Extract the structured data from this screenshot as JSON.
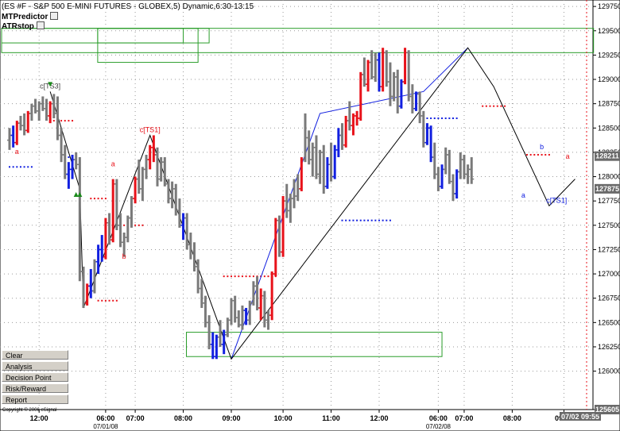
{
  "header": {
    "title": "(ES #F - S&P 500 E-MINI FUTURES - GLOBEX,5) Dynamic,6:30-13:15",
    "study1": "MTPredictor",
    "study2": "ATRstop"
  },
  "side_buttons": [
    "Clear",
    "Analysis",
    "Decision Point",
    "Risk/Reward",
    "Report"
  ],
  "copyright": "Copyright © 2006 eSignal",
  "colors": {
    "up": "#e8121a",
    "down": "#1220e0",
    "neutral": "#7a7a7a",
    "stop": "#e8121a",
    "stop_blue": "#1220e0",
    "box": "#2a9d2a",
    "grid": "#9a9a9a",
    "marker_bg": "#6a6a6a",
    "marker_dark": "#404040"
  },
  "chart_data": {
    "type": "candlestick",
    "symbol": "ES #F",
    "interval": "5",
    "ylim": [
      1256.05,
      1298.0
    ],
    "y_ticks": [
      1260.0,
      1262.5,
      1265.0,
      1267.5,
      1270.0,
      1272.5,
      1275.0,
      1277.5,
      1280.0,
      1282.5,
      1285.0,
      1287.5,
      1290.0,
      1292.5,
      1295.0,
      1297.5
    ],
    "y_tick_labels": [
      "126000",
      "126250",
      "126500",
      "126750",
      "127000",
      "127250",
      "127500",
      "127750",
      "128000",
      "128250",
      "128500",
      "128750",
      "129000",
      "129250",
      "129500",
      "129750"
    ],
    "price_markers": [
      {
        "label": "128211",
        "value": 1282.11
      },
      {
        "label": "127875",
        "value": 1278.75
      },
      {
        "label": "125605",
        "value": 1256.05
      }
    ],
    "x_ticks": [
      {
        "label": "12:00",
        "bar": 8
      },
      {
        "label": "06:00",
        "bar": 26
      },
      {
        "label": "07:00",
        "bar": 34
      },
      {
        "label": "08:00",
        "bar": 47
      },
      {
        "label": "09:00",
        "bar": 60
      },
      {
        "label": "10:00",
        "bar": 74
      },
      {
        "label": "11:00",
        "bar": 87
      },
      {
        "label": "12:00",
        "bar": 100
      },
      {
        "label": "06:00",
        "bar": 116
      },
      {
        "label": "07:00",
        "bar": 123
      },
      {
        "label": "08:00",
        "bar": 136
      },
      {
        "label": "09:00",
        "bar": 150
      }
    ],
    "date_labels": [
      {
        "label": "07/01/08",
        "bar": 26
      },
      {
        "label": "07/02/08",
        "bar": 116
      }
    ],
    "current_time_label": "07/02 09:55",
    "bars": [
      [
        1283.75,
        1285.0,
        1282.75,
        1284.25,
        "n"
      ],
      [
        1284.25,
        1285.25,
        1283.0,
        1283.5,
        "b"
      ],
      [
        1283.5,
        1285.75,
        1283.25,
        1285.5,
        "r"
      ],
      [
        1285.5,
        1286.25,
        1284.75,
        1285.25,
        "n"
      ],
      [
        1285.25,
        1286.5,
        1284.25,
        1284.75,
        "n"
      ],
      [
        1284.75,
        1286.75,
        1284.5,
        1286.5,
        "r"
      ],
      [
        1286.5,
        1287.5,
        1285.75,
        1287.25,
        "n"
      ],
      [
        1287.25,
        1288.0,
        1286.5,
        1286.75,
        "n"
      ],
      [
        1286.75,
        1287.75,
        1285.75,
        1287.5,
        "n"
      ],
      [
        1287.5,
        1288.25,
        1286.75,
        1287.0,
        "n"
      ],
      [
        1287.0,
        1288.0,
        1285.75,
        1286.25,
        "n"
      ],
      [
        1286.25,
        1287.75,
        1285.5,
        1287.5,
        "r"
      ],
      [
        1287.5,
        1288.5,
        1286.0,
        1286.5,
        "n"
      ],
      [
        1286.5,
        1288.25,
        1283.75,
        1284.25,
        "n"
      ],
      [
        1284.25,
        1285.0,
        1281.5,
        1282.25,
        "n"
      ],
      [
        1282.25,
        1283.25,
        1279.75,
        1280.25,
        "n"
      ],
      [
        1280.25,
        1281.5,
        1278.75,
        1280.75,
        "b"
      ],
      [
        1280.75,
        1282.25,
        1279.75,
        1281.75,
        "b"
      ],
      [
        1281.75,
        1282.5,
        1280.75,
        1281.25,
        "n"
      ],
      [
        1281.25,
        1282.0,
        1269.25,
        1270.25,
        "n"
      ],
      [
        1270.25,
        1270.75,
        1266.5,
        1267.0,
        "n"
      ],
      [
        1267.0,
        1269.0,
        1266.75,
        1268.75,
        "r"
      ],
      [
        1268.75,
        1270.5,
        1267.5,
        1268.25,
        "b"
      ],
      [
        1268.25,
        1271.5,
        1268.0,
        1271.25,
        "n"
      ],
      [
        1271.25,
        1273.0,
        1270.0,
        1272.5,
        "b"
      ],
      [
        1272.5,
        1274.0,
        1271.25,
        1271.75,
        "b"
      ],
      [
        1271.75,
        1275.75,
        1271.5,
        1275.25,
        "r"
      ],
      [
        1275.25,
        1276.25,
        1273.0,
        1273.5,
        "n"
      ],
      [
        1273.5,
        1279.75,
        1273.25,
        1279.25,
        "r"
      ],
      [
        1279.25,
        1279.75,
        1274.5,
        1275.0,
        "n"
      ],
      [
        1275.0,
        1276.25,
        1272.75,
        1273.25,
        "n"
      ],
      [
        1273.25,
        1274.25,
        1271.75,
        1273.75,
        "n"
      ],
      [
        1273.75,
        1276.0,
        1273.25,
        1275.75,
        "n"
      ],
      [
        1275.75,
        1278.0,
        1274.75,
        1277.75,
        "n"
      ],
      [
        1277.75,
        1280.0,
        1277.25,
        1279.75,
        "r"
      ],
      [
        1279.75,
        1281.75,
        1278.25,
        1278.75,
        "n"
      ],
      [
        1278.75,
        1281.0,
        1277.5,
        1280.75,
        "n"
      ],
      [
        1280.75,
        1282.25,
        1279.75,
        1281.75,
        "n"
      ],
      [
        1281.75,
        1283.25,
        1280.75,
        1283.0,
        "r"
      ],
      [
        1283.0,
        1284.25,
        1281.5,
        1282.25,
        "r"
      ],
      [
        1282.25,
        1283.0,
        1279.0,
        1279.75,
        "n"
      ],
      [
        1279.75,
        1282.0,
        1279.5,
        1281.5,
        "n"
      ],
      [
        1281.5,
        1282.0,
        1279.0,
        1279.25,
        "n"
      ],
      [
        1279.25,
        1279.75,
        1277.25,
        1277.75,
        "n"
      ],
      [
        1277.75,
        1279.5,
        1276.75,
        1278.75,
        "n"
      ],
      [
        1278.75,
        1279.25,
        1276.0,
        1276.5,
        "n"
      ],
      [
        1276.5,
        1277.75,
        1274.75,
        1275.0,
        "n"
      ],
      [
        1275.0,
        1276.25,
        1273.5,
        1275.75,
        "b"
      ],
      [
        1275.75,
        1276.25,
        1272.5,
        1273.0,
        "n"
      ],
      [
        1273.0,
        1274.25,
        1271.5,
        1272.25,
        "n"
      ],
      [
        1272.25,
        1273.25,
        1270.25,
        1270.75,
        "n"
      ],
      [
        1270.75,
        1271.5,
        1268.0,
        1268.5,
        "n"
      ],
      [
        1268.5,
        1269.5,
        1266.5,
        1267.0,
        "n"
      ],
      [
        1267.0,
        1267.75,
        1264.5,
        1265.0,
        "n"
      ],
      [
        1265.0,
        1265.75,
        1262.25,
        1262.75,
        "n"
      ],
      [
        1262.75,
        1264.0,
        1261.25,
        1261.5,
        "b"
      ],
      [
        1261.5,
        1263.75,
        1261.25,
        1263.5,
        "b"
      ],
      [
        1263.5,
        1265.25,
        1262.5,
        1262.75,
        "n"
      ],
      [
        1262.75,
        1264.25,
        1261.75,
        1263.75,
        "b"
      ],
      [
        1263.75,
        1265.5,
        1263.5,
        1265.25,
        "n"
      ],
      [
        1265.25,
        1267.5,
        1264.75,
        1267.25,
        "n"
      ],
      [
        1267.25,
        1267.75,
        1265.0,
        1265.5,
        "n"
      ],
      [
        1265.5,
        1266.25,
        1264.5,
        1264.75,
        "n"
      ],
      [
        1264.75,
        1266.75,
        1264.25,
        1266.25,
        "n"
      ],
      [
        1266.25,
        1266.5,
        1264.75,
        1265.25,
        "b"
      ],
      [
        1265.25,
        1267.25,
        1264.75,
        1267.0,
        "n"
      ],
      [
        1267.0,
        1269.25,
        1266.75,
        1268.75,
        "n"
      ],
      [
        1268.75,
        1269.75,
        1266.25,
        1266.5,
        "n"
      ],
      [
        1266.5,
        1268.5,
        1265.25,
        1267.75,
        "r"
      ],
      [
        1267.75,
        1268.25,
        1264.5,
        1265.25,
        "n"
      ],
      [
        1265.25,
        1266.25,
        1264.25,
        1265.75,
        "n"
      ],
      [
        1265.75,
        1270.25,
        1265.25,
        1270.0,
        "r"
      ],
      [
        1270.0,
        1275.75,
        1269.75,
        1275.5,
        "r"
      ],
      [
        1275.5,
        1276.0,
        1271.75,
        1272.25,
        "n"
      ],
      [
        1272.25,
        1278.0,
        1271.75,
        1277.5,
        "r"
      ],
      [
        1277.5,
        1279.25,
        1275.75,
        1276.5,
        "n"
      ],
      [
        1276.5,
        1278.25,
        1275.25,
        1277.75,
        "n"
      ],
      [
        1277.75,
        1279.75,
        1276.75,
        1278.0,
        "n"
      ],
      [
        1278.0,
        1280.25,
        1277.5,
        1278.75,
        "n"
      ],
      [
        1278.75,
        1282.0,
        1278.5,
        1281.75,
        "r"
      ],
      [
        1281.75,
        1286.5,
        1281.5,
        1284.0,
        "n"
      ],
      [
        1284.0,
        1284.75,
        1281.25,
        1281.75,
        "n"
      ],
      [
        1281.75,
        1283.5,
        1280.0,
        1283.0,
        "n"
      ],
      [
        1283.0,
        1284.25,
        1279.75,
        1280.25,
        "n"
      ],
      [
        1280.25,
        1282.75,
        1279.25,
        1282.5,
        "n"
      ],
      [
        1282.5,
        1283.25,
        1278.25,
        1279.0,
        "n"
      ],
      [
        1279.0,
        1282.0,
        1278.75,
        1281.25,
        "b"
      ],
      [
        1281.25,
        1283.5,
        1279.5,
        1280.0,
        "n"
      ],
      [
        1280.0,
        1283.25,
        1279.75,
        1282.75,
        "b"
      ],
      [
        1282.75,
        1285.0,
        1282.0,
        1284.25,
        "b"
      ],
      [
        1284.25,
        1285.5,
        1282.75,
        1283.25,
        "n"
      ],
      [
        1283.25,
        1286.25,
        1283.0,
        1285.75,
        "r"
      ],
      [
        1285.75,
        1287.75,
        1284.75,
        1285.25,
        "n"
      ],
      [
        1285.25,
        1286.5,
        1284.25,
        1286.25,
        "r"
      ],
      [
        1286.25,
        1286.75,
        1285.25,
        1286.0,
        "r"
      ],
      [
        1286.0,
        1290.75,
        1285.75,
        1290.5,
        "r"
      ],
      [
        1290.5,
        1292.25,
        1289.25,
        1289.5,
        "n"
      ],
      [
        1289.5,
        1292.0,
        1288.75,
        1291.75,
        "r"
      ],
      [
        1291.75,
        1293.0,
        1290.0,
        1290.25,
        "n"
      ],
      [
        1290.25,
        1292.75,
        1289.75,
        1292.0,
        "n"
      ],
      [
        1292.0,
        1292.75,
        1288.75,
        1289.25,
        "b"
      ],
      [
        1289.25,
        1293.25,
        1288.75,
        1292.75,
        "r"
      ],
      [
        1292.75,
        1293.0,
        1289.25,
        1289.75,
        "n"
      ],
      [
        1289.75,
        1291.75,
        1287.25,
        1288.25,
        "n"
      ],
      [
        1288.25,
        1290.75,
        1287.75,
        1290.25,
        "n"
      ],
      [
        1290.25,
        1291.0,
        1286.5,
        1287.25,
        "n"
      ],
      [
        1287.25,
        1290.0,
        1287.0,
        1289.75,
        "b"
      ],
      [
        1289.75,
        1293.25,
        1289.5,
        1292.75,
        "r"
      ],
      [
        1292.75,
        1293.0,
        1287.75,
        1288.25,
        "n"
      ],
      [
        1288.25,
        1289.5,
        1286.5,
        1287.0,
        "n"
      ],
      [
        1287.0,
        1288.75,
        1286.75,
        1288.5,
        "b"
      ],
      [
        1288.5,
        1288.75,
        1285.5,
        1286.25,
        "n"
      ],
      [
        1286.25,
        1286.75,
        1283.0,
        1283.5,
        "n"
      ],
      [
        1283.5,
        1285.5,
        1283.25,
        1285.0,
        "b"
      ],
      [
        1285.0,
        1285.25,
        1281.5,
        1282.0,
        "b"
      ],
      [
        1282.0,
        1283.5,
        1279.75,
        1280.25,
        "n"
      ],
      [
        1280.25,
        1281.0,
        1278.5,
        1279.0,
        "n"
      ],
      [
        1279.0,
        1281.25,
        1278.75,
        1280.75,
        "b"
      ],
      [
        1280.75,
        1283.0,
        1280.25,
        1282.25,
        "n"
      ],
      [
        1282.25,
        1282.75,
        1279.25,
        1279.5,
        "n"
      ],
      [
        1279.5,
        1280.25,
        1277.5,
        1278.25,
        "n"
      ],
      [
        1278.25,
        1280.75,
        1277.75,
        1280.5,
        "b"
      ],
      [
        1280.5,
        1282.5,
        1279.75,
        1281.75,
        "n"
      ],
      [
        1281.75,
        1282.25,
        1279.75,
        1280.25,
        "n"
      ],
      [
        1280.25,
        1281.25,
        1279.25,
        1280.75,
        "n"
      ],
      [
        1280.75,
        1282.0,
        1279.25,
        1279.75,
        "n"
      ]
    ],
    "atr_stop": [
      {
        "from": 0,
        "to": 6,
        "value": 1281.0,
        "side": "b"
      },
      {
        "from": 12,
        "to": 17,
        "value": 1285.75,
        "side": "r"
      },
      {
        "from": 14,
        "to": 17,
        "value": 1282.0,
        "side": "b"
      },
      {
        "from": 22,
        "to": 26,
        "value": 1277.75,
        "side": "r"
      },
      {
        "from": 24,
        "to": 29,
        "value": 1267.25,
        "side": "r"
      },
      {
        "from": 30,
        "to": 36,
        "value": 1275.0,
        "side": "r"
      },
      {
        "from": 58,
        "to": 72,
        "value": 1269.75,
        "side": "r"
      },
      {
        "from": 90,
        "to": 103,
        "value": 1275.5,
        "side": "b"
      },
      {
        "from": 113,
        "to": 121,
        "value": 1286.0,
        "side": "b"
      },
      {
        "from": 128,
        "to": 134,
        "value": 1287.25,
        "side": "r"
      },
      {
        "from": 140,
        "to": 146,
        "value": 1282.25,
        "side": "r"
      }
    ],
    "annotations": [
      {
        "text": "c[TS3]",
        "bar": 11,
        "value": 1288.75,
        "color": "#404040"
      },
      {
        "text": "c[TS1]",
        "bar": 38,
        "value": 1284.25,
        "color": "#e8121a"
      },
      {
        "text": "c[TS1]",
        "bar": 148,
        "value": 1277.0,
        "color": "#1220e0"
      },
      {
        "text": "a",
        "bar": 2,
        "value": 1282.0,
        "color": "#e8121a"
      },
      {
        "text": "a",
        "bar": 28,
        "value": 1280.75,
        "color": "#e8121a"
      },
      {
        "text": "b",
        "bar": 31,
        "value": 1271.25,
        "color": "#e8121a"
      },
      {
        "text": "a",
        "bar": 139,
        "value": 1277.5,
        "color": "#1220e0"
      },
      {
        "text": "b",
        "bar": 144,
        "value": 1282.5,
        "color": "#1220e0"
      },
      {
        "text": "a",
        "bar": 151,
        "value": 1281.5,
        "color": "#e8121a"
      }
    ],
    "zigzag_black": [
      [
        11,
        1288.75
      ],
      [
        19,
        1278.75
      ],
      [
        20,
        1266.5
      ],
      [
        38,
        1284.25
      ],
      [
        60,
        1261.25
      ],
      [
        124,
        1293.25
      ],
      [
        131,
        1289.25
      ],
      [
        146,
        1277.0
      ],
      [
        153,
        1279.75
      ]
    ],
    "zigzag_blue": [
      [
        60,
        1261.25
      ],
      [
        84,
        1286.5
      ],
      [
        112,
        1288.75
      ],
      [
        124,
        1293.25
      ]
    ],
    "boxes": [
      {
        "bar_from": 0,
        "bar_to": 54,
        "y_from": 1293.75,
        "y_to": 1295.25
      },
      {
        "bar_from": 0,
        "bar_to": 158,
        "y_from": 1292.75,
        "y_to": 1295.25
      },
      {
        "bar_from": 26,
        "bar_to": 51,
        "y_from": 1291.75,
        "y_to": 1295.25
      },
      {
        "bar_from": 26,
        "bar_to": 47,
        "y_from": 1293.75,
        "y_to": 1295.25
      },
      {
        "bar_from": 50,
        "bar_to": 117,
        "y_from": 1261.5,
        "y_to": 1264.0
      }
    ]
  }
}
